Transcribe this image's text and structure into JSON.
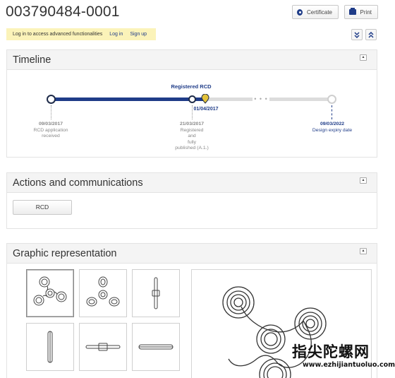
{
  "header": {
    "title": "003790484-0001",
    "certificate_label": "Certificate",
    "print_label": "Print"
  },
  "login_banner": {
    "text": "Log in to access advanced functionalities",
    "login_link": "Log in",
    "signup_link": "Sign up"
  },
  "timeline": {
    "title": "Timeline",
    "status_label": "Registered RCD",
    "current_date": "01/04/2017",
    "progress_fraction": 0.55,
    "events": [
      {
        "date": "09/03/2017",
        "lines": [
          "RCD application",
          "received"
        ]
      },
      {
        "date": "21/03/2017",
        "lines": [
          "Registered",
          "and",
          "fully",
          "published (A.1.)"
        ]
      },
      {
        "date": "09/03/2022",
        "lines": [
          "Design expiry date"
        ]
      }
    ]
  },
  "actions": {
    "title": "Actions and communications",
    "rcd_label": "RCD"
  },
  "graphic": {
    "title": "Graphic representation",
    "thumbnails": [
      "view-1",
      "view-2",
      "view-3",
      "view-4",
      "view-5",
      "view-6"
    ]
  },
  "watermark": {
    "text": "指尖陀螺网",
    "url": "www.ezhijiantuoluo.com"
  },
  "colors": {
    "accent": "#1f3c88",
    "banner": "#fbf3b9",
    "marker": "#e3c23a"
  }
}
